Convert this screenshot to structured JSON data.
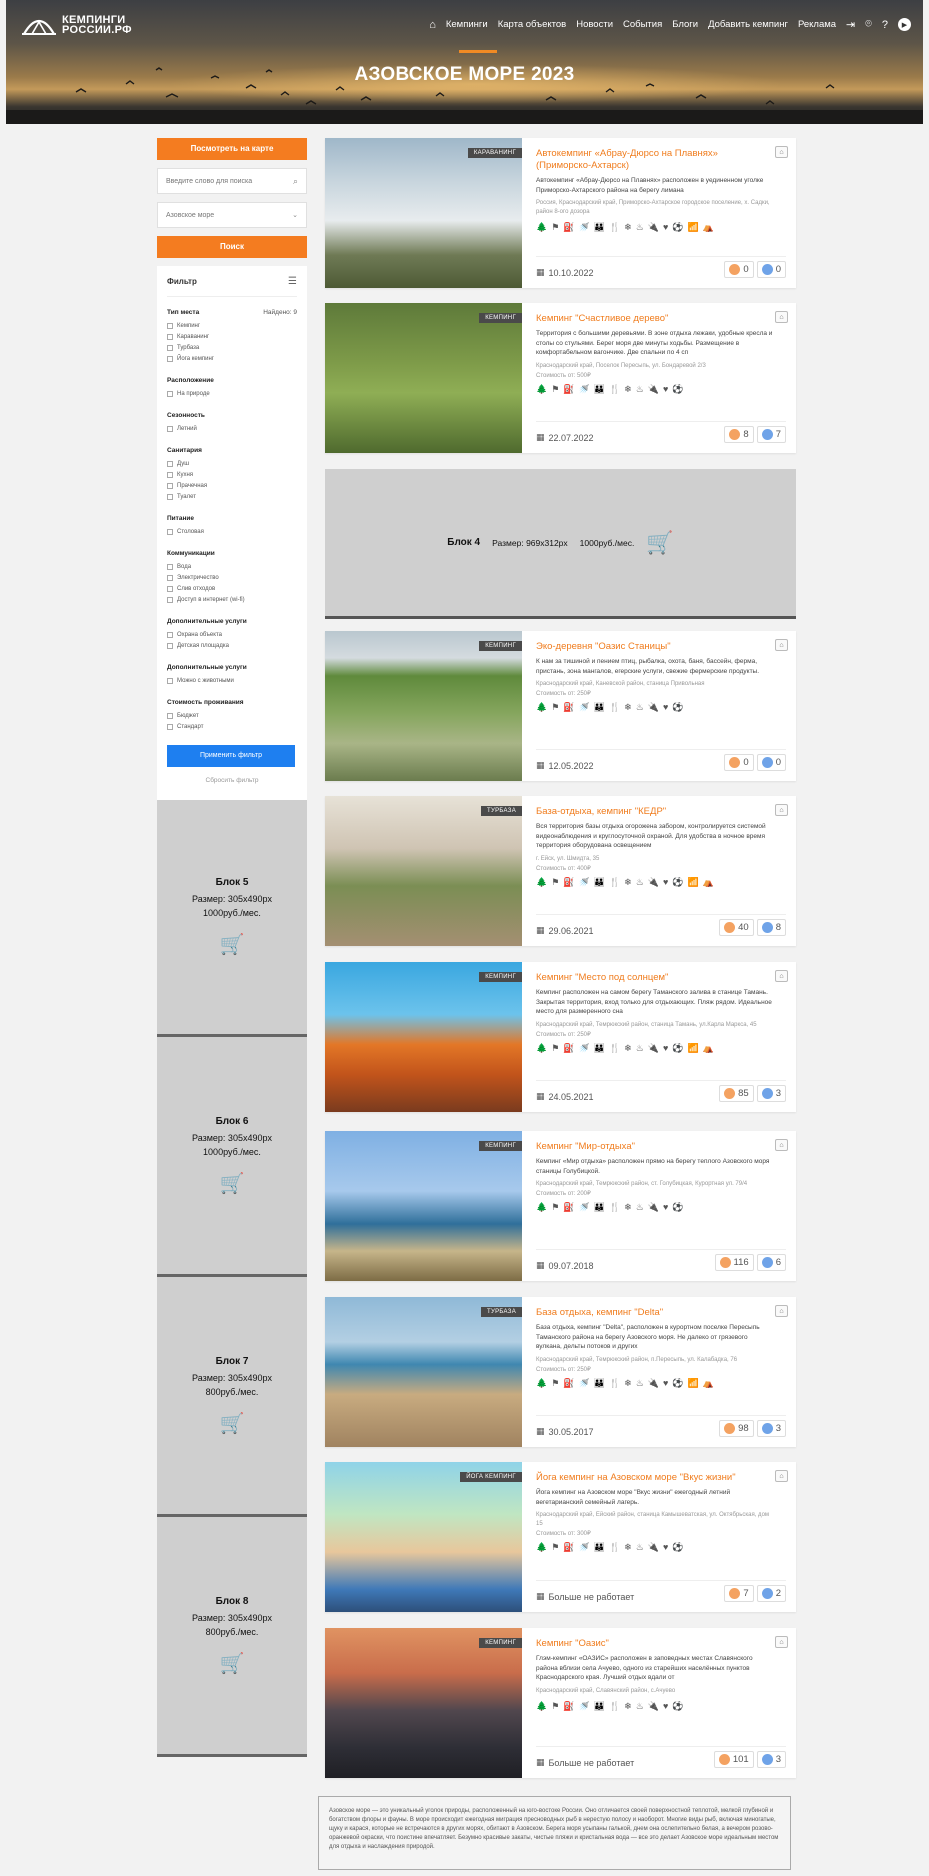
{
  "header": {
    "logo_line1": "КЕМПИНГИ",
    "logo_line2": "РОССИИ.РФ",
    "nav": [
      "Кемпинги",
      "Карта объектов",
      "Новости",
      "События",
      "Блоги",
      "Добавить кемпинг",
      "Реклама"
    ],
    "title": "АЗОВСКОЕ МОРЕ 2023"
  },
  "sidebar": {
    "map_button": "Посмотреть на карте",
    "search_placeholder": "Введите слово для поиска",
    "region": "Азовское море",
    "search_button": "Поиск",
    "filter_title": "Фильтр",
    "found": "Найдено: 9",
    "groups": [
      {
        "title": "Тип места",
        "options": [
          "Кемпинг",
          "Караванинг",
          "Турбаза",
          "Йога кемпинг"
        ]
      },
      {
        "title": "Расположение",
        "options": [
          "На природе"
        ]
      },
      {
        "title": "Сезонность",
        "options": [
          "Летний"
        ]
      },
      {
        "title": "Санитария",
        "options": [
          "Душ",
          "Кухня",
          "Прачечная",
          "Туалет"
        ]
      },
      {
        "title": "Питание",
        "options": [
          "Столовая"
        ]
      },
      {
        "title": "Коммуникации",
        "options": [
          "Вода",
          "Электричество",
          "Слив отходов",
          "Доступ в интернет (wi-fi)"
        ]
      },
      {
        "title": "Дополнительные услуги",
        "options": [
          "Охрана объекта",
          "Детская площадка"
        ]
      },
      {
        "title": "Дополнительные услуги",
        "options": [
          "Можно с животными"
        ]
      },
      {
        "title": "Стоимость проживания",
        "options": [
          "Бюджет",
          "Стандарт"
        ]
      }
    ],
    "apply_button": "Применить фильтр",
    "reset_link": "Сбросить фильтр",
    "ads": [
      {
        "title": "Блок 5",
        "size": "Размер: 305x490px",
        "price": "1000руб./мес."
      },
      {
        "title": "Блок 6",
        "size": "Размер: 305x490px",
        "price": "1000руб./мес."
      },
      {
        "title": "Блок 7",
        "size": "Размер: 305x490px",
        "price": "800руб./мес."
      },
      {
        "title": "Блок 8",
        "size": "Размер: 305x490px",
        "price": "800руб./мес."
      }
    ]
  },
  "wide_ad": {
    "title": "Блок 4",
    "size": "Размер: 969x312px",
    "price": "1000руб./мес."
  },
  "listings": [
    {
      "tag": "КАРАВАНИНГ",
      "title": "Автокемпинг «Абрау-Дюрсо на Плавнях» (Приморско-Ахтарск)",
      "desc": "Автокемпинг «Абрау-Дюрсо на Плавнях» расположен в уединенном уголке Приморско-Ахтарского района на берегу лимана",
      "addr": "Россия, Краснодарский край, Приморско-Ахтарское городское поселение, х. Садки, район 8-ого дозора",
      "price": "",
      "date": "10.10.2022",
      "likes": "0",
      "comments": "0"
    },
    {
      "tag": "КЕМПИНГ",
      "title": "Кемпинг \"Счастливое дерево\"",
      "desc": "Территория с большими деревьями. В зоне отдыха лежаки, удобные кресла и столы со стульями. Берег моря две минуты ходьбы. Размещение в комфортабельном вагончике. Две спальни по 4 сп",
      "addr": "Краснодарский край, Поселок Пересыпь, ул. Бондаревой 2/3",
      "price": "Стоимость от: 500₽",
      "date": "22.07.2022",
      "likes": "8",
      "comments": "7"
    },
    {
      "tag": "КЕМПИНГ",
      "title": "Эко-деревня \"Оазис Станицы\"",
      "desc": "К нам за тишиной и пением птиц, рыбалка, охота, баня, бассейн, ферма, пристань, зона мангалов, егерские услуги, свежие фермерские продукты.",
      "addr": "Краснодарский край, Каневской район, станица Привольная",
      "price": "Стоимость от: 250₽",
      "date": "12.05.2022",
      "likes": "0",
      "comments": "0"
    },
    {
      "tag": "ТУРБАЗА",
      "title": "База-отдыха, кемпинг \"КЕДР\"",
      "desc": "Вся территория базы отдыха огорожена забором, контролируется системой видеонаблюдения и круглосуточной охраной. Для удобства в ночное время территория оборудована освещением",
      "addr": "г. Ейск, ул. Шмидта, 35",
      "price": "Стоимость от: 400₽",
      "date": "29.06.2021",
      "likes": "40",
      "comments": "8"
    },
    {
      "tag": "КЕМПИНГ",
      "title": "Кемпинг \"Место под солнцем\"",
      "desc": "Кемпинг расположен на самом берегу Таманского залива в станице Тамань. Закрытая территория, вход только для отдыхающих. Пляж рядом. Идеальное место для размеренного сна",
      "addr": "Краснодарский край, Темрюкский район, станица Тамань, ул.Карла Маркса, 45",
      "price": "Стоимость от: 250₽",
      "date": "24.05.2021",
      "likes": "85",
      "comments": "3"
    },
    {
      "tag": "КЕМПИНГ",
      "title": "Кемпинг \"Мир-отдыха\"",
      "desc": "Кемпинг «Мир отдыха» расположен прямо на берегу теплого Азовского моря станицы Голубицкой.",
      "addr": "Краснодарский край, Темрюкский район, ст. Голубицкая, Курортная ул. 79/4",
      "price": "Стоимость от: 200₽",
      "date": "09.07.2018",
      "likes": "116",
      "comments": "6"
    },
    {
      "tag": "ТУРБАЗА",
      "title": "База отдыха, кемпинг \"Delta\"",
      "desc": "База отдыха, кемпинг \"Delta\", расположен в курортном поселке Пересыпь Таманского района на берегу Азовского моря. Не далеко от грязевого вулкана, дельты потоков и других",
      "addr": "Краснодарский край, Темрюкский район, п.Пересыпь, ул. Калабадка, 76",
      "price": "Стоимость от: 250₽",
      "date": "30.05.2017",
      "likes": "98",
      "comments": "3"
    },
    {
      "tag": "ЙОГА КЕМПИНГ",
      "title": "Йога кемпинг на Азовском море \"Вкус жизни\"",
      "desc": "Йога кемпинг на Азовском море \"Вкус жизни\" ежегодный летний вегетарианский семейный лагерь.",
      "addr": "Краснодарский край, Ейский район, станица Камышеватская, ул. Октябрьская, дом 15",
      "price": "Стоимость от: 300₽",
      "date": "Больше не работает",
      "likes": "7",
      "comments": "2"
    },
    {
      "tag": "КЕМПИНГ",
      "title": "Кемпинг \"Оазис\"",
      "desc": "Глэм-кемпинг «ОАЗИС» расположен в заповедных местах Славянского района вблизи села Ачуево, одного из старейших населённых пунктов Краснодарского края. Лучший отдых вдали от",
      "addr": "Краснодарский край, Славянский район, с.Ачуево",
      "price": "",
      "date": "Больше не работает",
      "likes": "101",
      "comments": "3"
    }
  ],
  "seo_text": "Азовское море — это уникальный уголок природы, расположенный на юго-востоке России. Оно отличается своей поверхностной теплотой, мелкой глубиной и богатством флоры и фауны. В море происходит ежегодная миграция пресноводных рыб в нерестую полосу и наоборот. Многие виды рыб, включая миногатые, щуку и карася, которые не встречаются в других морях, обитают в Азовском. Берега моря усыпаны галькой, днем она ослепительно белая, а вечером розово-оранжевой окраски, что поистине впечатляет. Безумно красивые закаты, чистые пляжи и кристальная вода — все это делает Азовское море идеальным местом для отдыха и наслаждения природой.",
  "colors": {
    "accent": "#f47c20",
    "primary_button": "#1e7ff0",
    "ad_bg": "#cfcfcf",
    "title_orange": "#f07c1d"
  }
}
